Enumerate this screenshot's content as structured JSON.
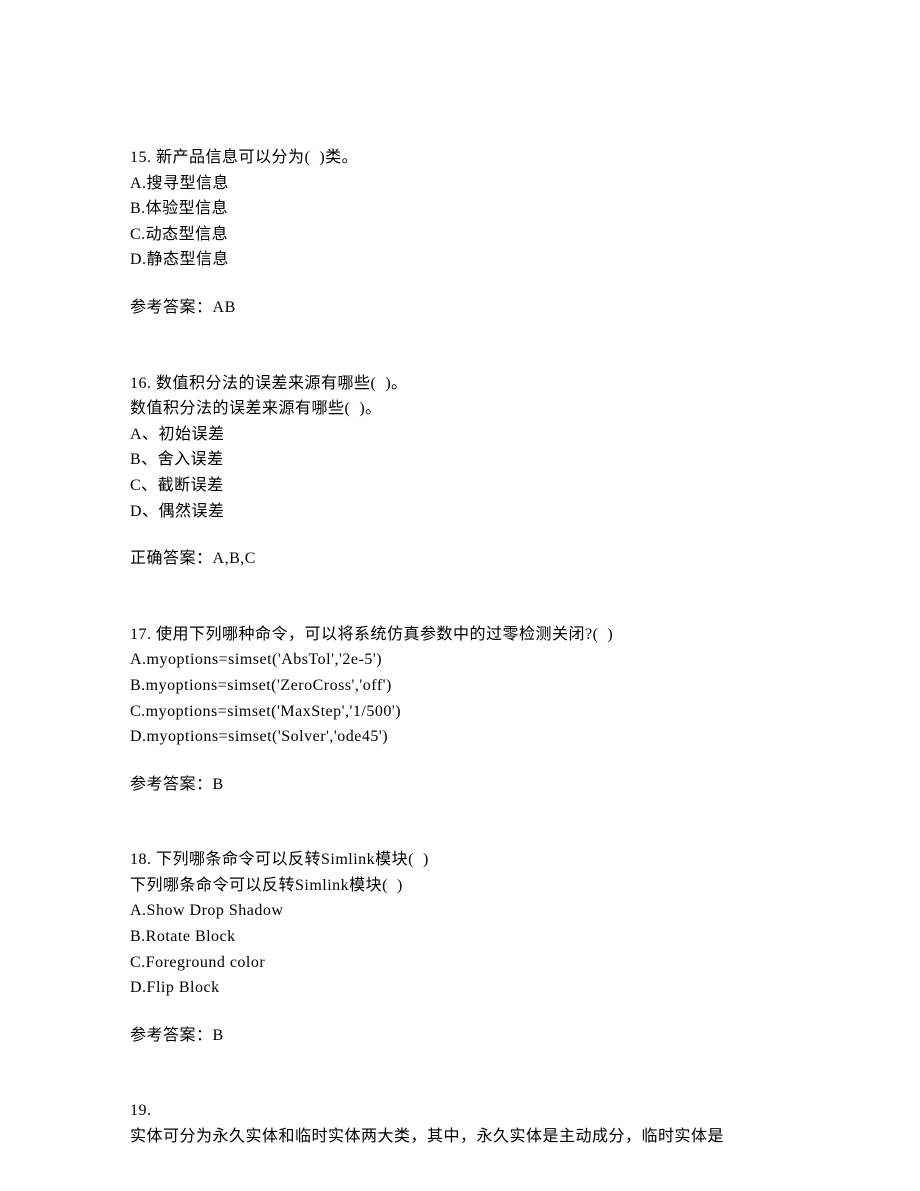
{
  "questions": [
    {
      "number": "15.",
      "stem": "新产品信息可以分为(  )类。",
      "options": [
        "A.搜寻型信息",
        "B.体验型信息",
        "C.动态型信息",
        "D.静态型信息"
      ],
      "answer_label": "参考答案：",
      "answer_value": "AB"
    },
    {
      "number": "16.",
      "stem": "数值积分法的误差来源有哪些(  )。",
      "stem_repeat": "数值积分法的误差来源有哪些(  )。",
      "options": [
        "A、初始误差",
        "B、舍入误差",
        "C、截断误差",
        "D、偶然误差"
      ],
      "answer_label": "正确答案：",
      "answer_value": "A,B,C"
    },
    {
      "number": "17.",
      "stem": "使用下列哪种命令，可以将系统仿真参数中的过零检测关闭?(  )",
      "options": [
        "A.myoptions=simset('AbsTol','2e-5')",
        "B.myoptions=simset('ZeroCross','off')",
        "C.myoptions=simset('MaxStep','1/500')",
        "D.myoptions=simset('Solver','ode45')"
      ],
      "answer_label": "参考答案：",
      "answer_value": "B"
    },
    {
      "number": "18.",
      "stem": "下列哪条命令可以反转Simlink模块(  )",
      "stem_repeat": "下列哪条命令可以反转Simlink模块(  )",
      "options": [
        "A.Show Drop Shadow",
        "B.Rotate Block",
        "C.Foreground color",
        "D.Flip Block"
      ],
      "answer_label": "参考答案：",
      "answer_value": "B"
    },
    {
      "number": "19.",
      "stem": "",
      "stem_below": "实体可分为永久实体和临时实体两大类，其中，永久实体是主动成分，临时实体是"
    }
  ]
}
